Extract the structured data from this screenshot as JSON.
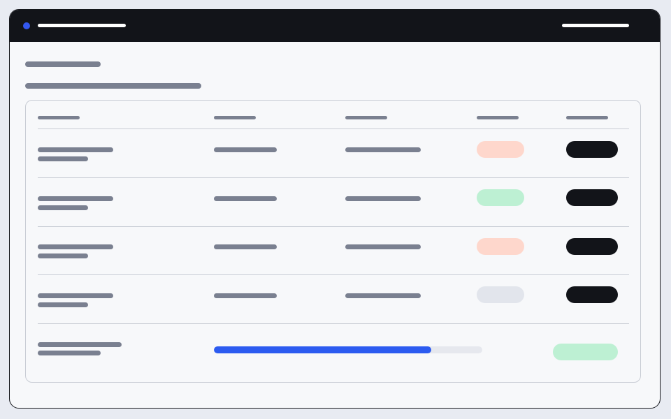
{
  "colors": {
    "titlebar": "#121419",
    "accent": "#3358f0",
    "content_background": "#f7f8fa",
    "status_danger": "#fed7cc",
    "status_success": "#bdf0d3",
    "status_neutral": "#e2e5ec",
    "action_button": "#121419",
    "progress_fill": "#2c5bf0",
    "progress_track": "#e6e8ee"
  },
  "table": {
    "rows": [
      {
        "status": "danger"
      },
      {
        "status": "success"
      },
      {
        "status": "danger"
      },
      {
        "status": "neutral"
      }
    ],
    "footer": {
      "progress_fraction": 0.81
    }
  }
}
